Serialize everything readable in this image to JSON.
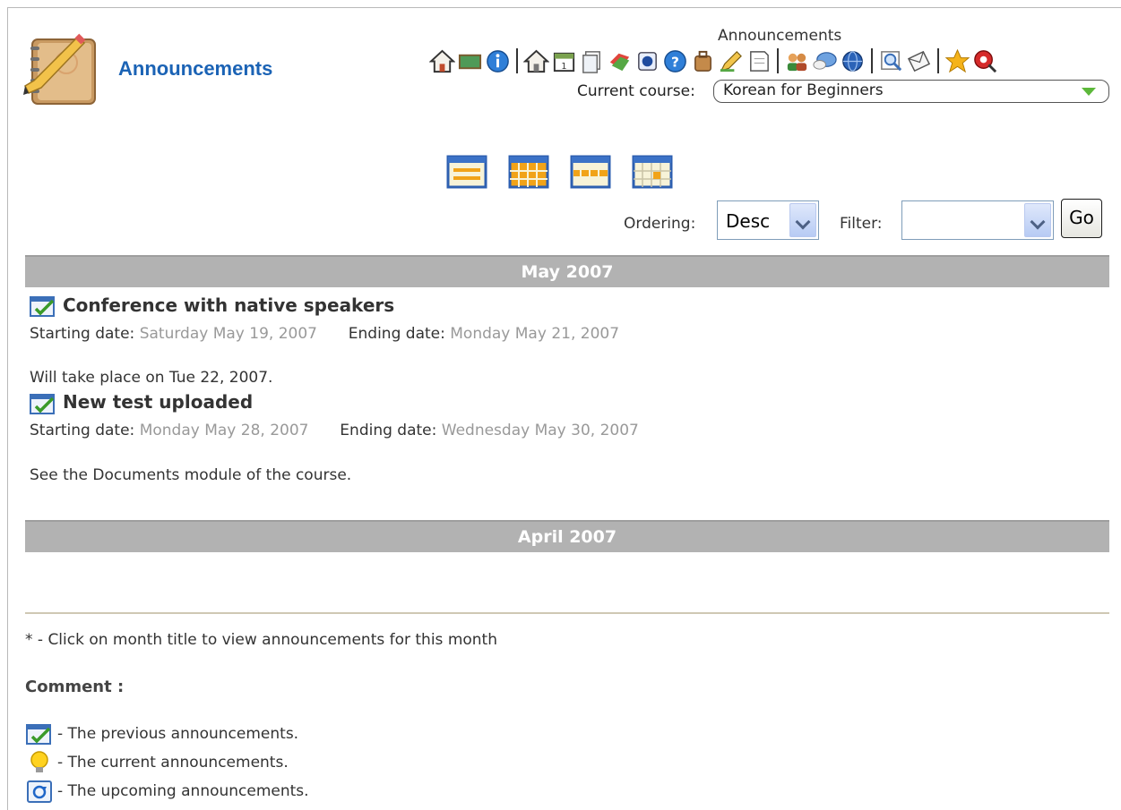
{
  "header": {
    "title": "Announcements",
    "toolbar_caption": "Announcements",
    "course_label": "Current course:",
    "course_value": "Korean for Beginners"
  },
  "toolbar_icons": [
    "home-icon",
    "blackboard-icon",
    "info-icon",
    "|",
    "course-home-icon",
    "calendar-icon",
    "documents-icon",
    "links-icon",
    "exercises-icon",
    "help-icon",
    "bag-icon",
    "pencil-icon",
    "assignments-icon",
    "|",
    "users-icon",
    "chat-icon",
    "globe-icon",
    "|",
    "search-icon",
    "mail-icon",
    "|",
    "star-icon",
    "logout-icon"
  ],
  "views": [
    "list-view",
    "month-view",
    "week-view",
    "day-view"
  ],
  "controls": {
    "ordering_label": "Ordering:",
    "ordering_value": "Desc",
    "filter_label": "Filter:",
    "filter_value": "",
    "go_label": "Go"
  },
  "months": [
    {
      "label": "May 2007",
      "announcements": [
        {
          "title": "Conference with native speakers",
          "start_label": "Starting date:",
          "start_value": "Saturday May 19, 2007",
          "end_label": "Ending date:",
          "end_value": "Monday May 21, 2007",
          "body": "Will take place on Tue 22, 2007."
        },
        {
          "title": "New test uploaded",
          "start_label": "Starting date:",
          "start_value": "Monday May 28, 2007",
          "end_label": "Ending date:",
          "end_value": "Wednesday May 30, 2007",
          "body": "See the Documents module of the course."
        }
      ]
    },
    {
      "label": "April 2007",
      "announcements": []
    }
  ],
  "footer": {
    "note": "* - Click on month title to view announcements for this month",
    "comment_title": "Comment :",
    "legend": [
      {
        "icon": "previous-announcement-icon",
        "text": "- The previous announcements."
      },
      {
        "icon": "current-announcement-icon",
        "text": "- The current announcements."
      },
      {
        "icon": "upcoming-announcement-icon",
        "text": "- The upcoming announcements."
      }
    ]
  }
}
